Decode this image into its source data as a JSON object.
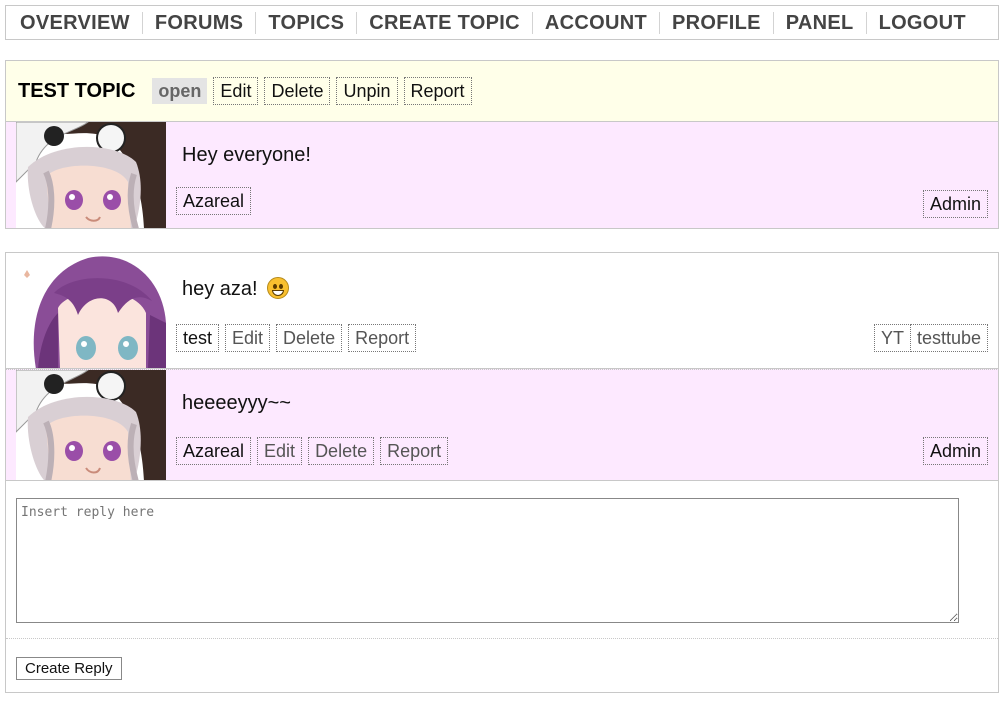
{
  "nav": {
    "items": [
      "OVERVIEW",
      "FORUMS",
      "TOPICS",
      "CREATE TOPIC",
      "ACCOUNT",
      "PROFILE",
      "PANEL",
      "LOGOUT"
    ]
  },
  "topic": {
    "title": "TEST TOPIC",
    "status": "open",
    "actions": [
      "Edit",
      "Delete",
      "Unpin",
      "Report"
    ]
  },
  "posts": [
    {
      "content": "Hey everyone!",
      "author": "Azareal",
      "role": "Admin",
      "bg": "#fde9ff",
      "avatar": "monokuma-hood-girl"
    },
    {
      "content": "hey aza!",
      "emoji": "grinning-emoji",
      "author": "test",
      "actions": [
        "Edit",
        "Delete",
        "Report"
      ],
      "tags": [
        "YT",
        "testtube"
      ],
      "bg": "#ffffff",
      "avatar": "purple-hair-girl"
    },
    {
      "content": "heeeeyyy~~",
      "author": "Azareal",
      "actions": [
        "Edit",
        "Delete",
        "Report"
      ],
      "role": "Admin",
      "bg": "#fde9ff",
      "avatar": "monokuma-hood-girl"
    }
  ],
  "reply": {
    "placeholder": "Insert reply here",
    "button": "Create Reply"
  }
}
